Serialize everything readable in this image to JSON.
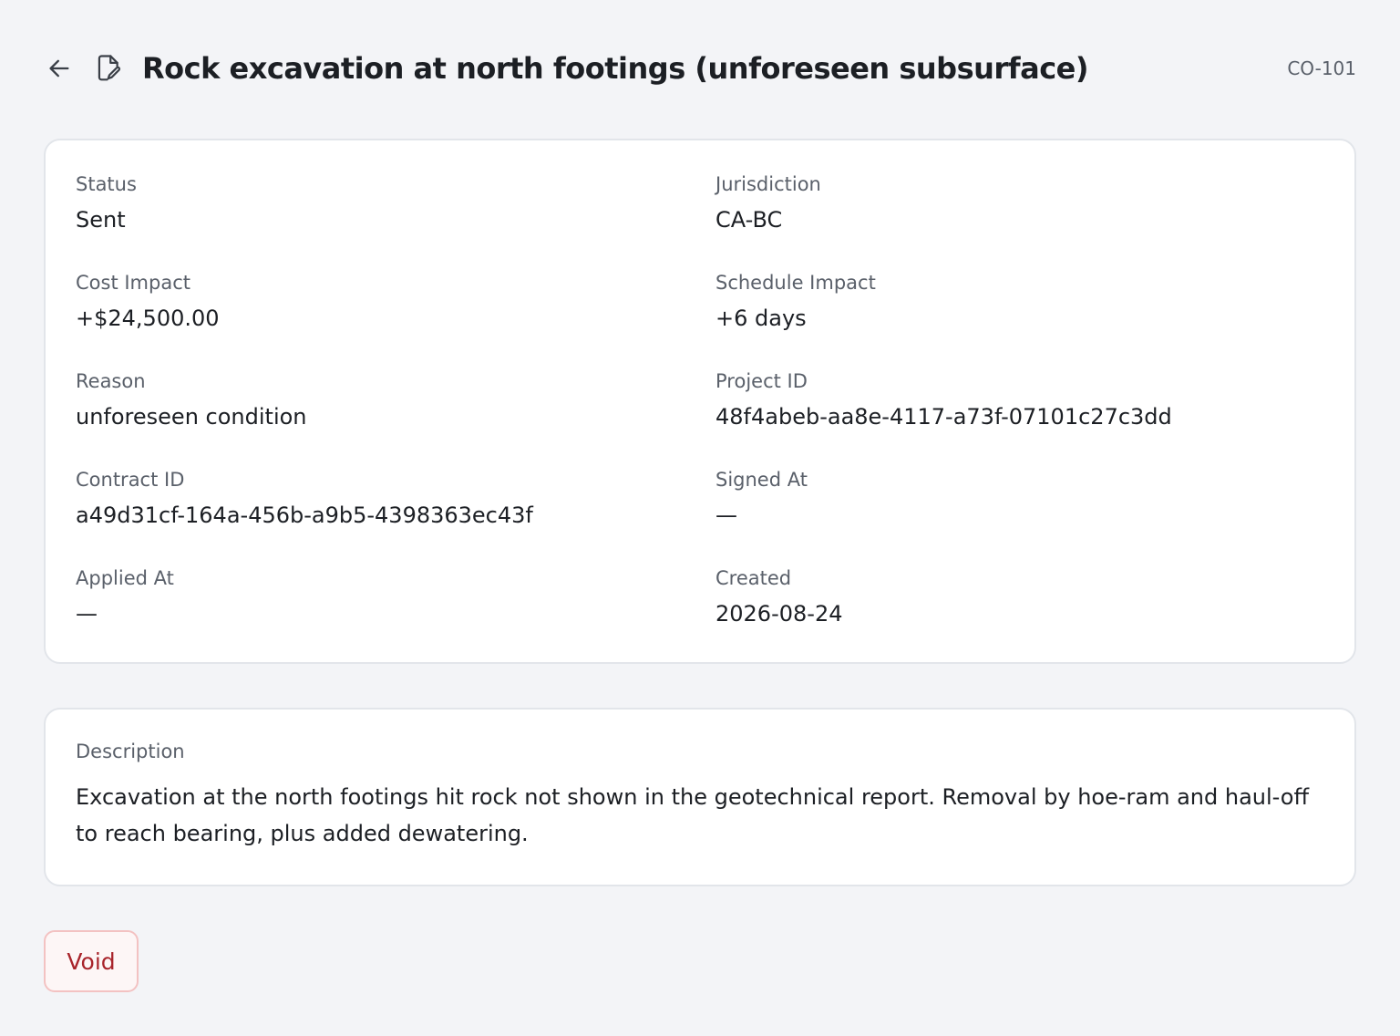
{
  "header": {
    "back_icon": "arrow-left-icon",
    "doc_icon": "document-edit-icon",
    "title": "Rock excavation at north footings (unforeseen subsurface)",
    "number": "CO-101"
  },
  "details": {
    "status": {
      "label": "Status",
      "value": "Sent"
    },
    "jurisdiction": {
      "label": "Jurisdiction",
      "value": "CA-BC"
    },
    "cost_impact": {
      "label": "Cost Impact",
      "value": "+$24,500.00"
    },
    "schedule_impact": {
      "label": "Schedule Impact",
      "value": "+6 days"
    },
    "reason": {
      "label": "Reason",
      "value": "unforeseen condition"
    },
    "project_id": {
      "label": "Project ID",
      "value": "48f4abeb-aa8e-4117-a73f-07101c27c3dd"
    },
    "contract_id": {
      "label": "Contract ID",
      "value": "a49d31cf-164a-456b-a9b5-4398363ec43f"
    },
    "signed_at": {
      "label": "Signed At",
      "value": "—"
    },
    "applied_at": {
      "label": "Applied At",
      "value": "—"
    },
    "created": {
      "label": "Created",
      "value": "2026-08-24"
    }
  },
  "description": {
    "label": "Description",
    "text": "Excavation at the north footings hit rock not shown in the geotechnical report. Removal by hoe-ram and haul-off to reach bearing, plus added dewatering."
  },
  "actions": {
    "void_label": "Void"
  },
  "colors": {
    "background": "#f3f4f7",
    "card": "#ffffff",
    "danger_text": "#a8242b",
    "danger_border": "#f3c2c2"
  }
}
